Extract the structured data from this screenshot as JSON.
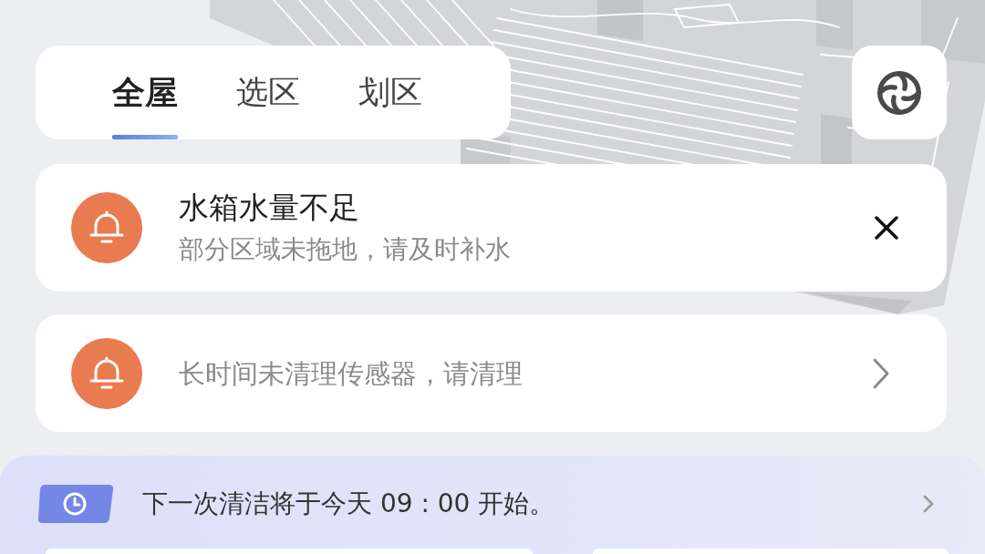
{
  "tabs": [
    {
      "label": "全屋",
      "selected": true
    },
    {
      "label": "选区",
      "selected": false
    },
    {
      "label": "划区",
      "selected": false
    }
  ],
  "alerts": [
    {
      "kind": "dismiss",
      "title": "水箱水量不足",
      "message": "部分区域未拖地，请及时补水"
    },
    {
      "kind": "link",
      "message": "长时间未清理传感器，请清理"
    }
  ],
  "schedule": {
    "text": "下一次清洁将于今天 09 : 00 开始。"
  }
}
